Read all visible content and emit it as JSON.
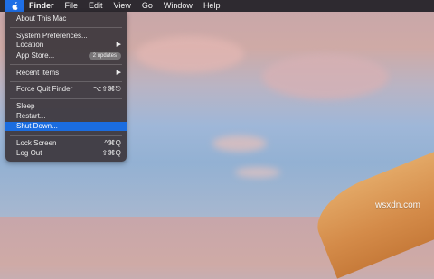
{
  "menubar": {
    "apple_icon": "apple-icon",
    "app_name": "Finder",
    "items": [
      "File",
      "Edit",
      "View",
      "Go",
      "Window",
      "Help"
    ]
  },
  "apple_menu": {
    "items": [
      {
        "label": "About This Mac"
      },
      {
        "label": "System Preferences..."
      },
      {
        "label": "Location",
        "submenu": "▶"
      },
      {
        "label": "App Store...",
        "badge": "2 updates"
      },
      {
        "label": "Recent Items",
        "submenu": "▶"
      },
      {
        "label": "Force Quit Finder",
        "shortcut": "⌥⇧⌘⎋"
      },
      {
        "label": "Sleep"
      },
      {
        "label": "Restart..."
      },
      {
        "label": "Shut Down...",
        "selected": true
      },
      {
        "label": "Lock Screen",
        "shortcut": "^⌘Q"
      },
      {
        "label": "Log Out",
        "shortcut": "⇧⌘Q"
      }
    ]
  },
  "watermark": "wsxdn.com",
  "colors": {
    "menubar_bg": "#2e2a30",
    "selection": "#1b6de0",
    "menu_bg": "#3c363c"
  }
}
